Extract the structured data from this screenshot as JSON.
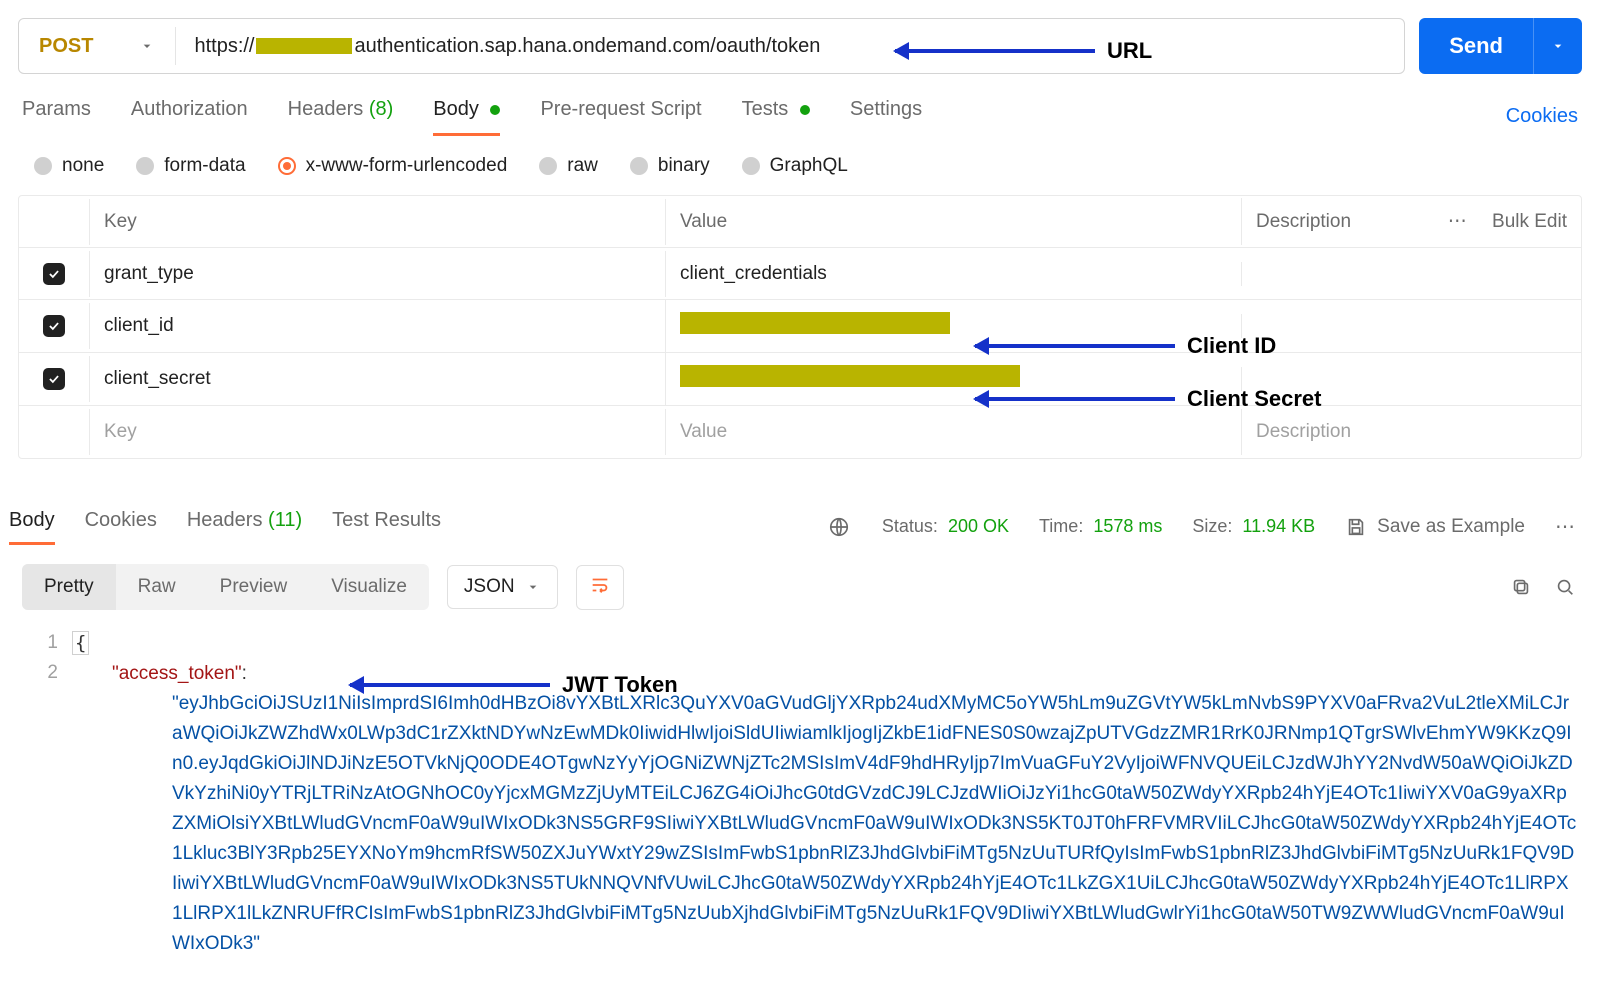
{
  "request": {
    "method": "POST",
    "url_parts": {
      "pre": "https://",
      "post": "authentication.sap.hana.ondemand.com/oauth/token"
    },
    "send_label": "Send"
  },
  "reqTabs": {
    "params": "Params",
    "authorization": "Authorization",
    "headers": "Headers",
    "headers_count": "(8)",
    "body": "Body",
    "prerequest": "Pre-request Script",
    "tests": "Tests",
    "settings": "Settings",
    "cookies": "Cookies"
  },
  "bodyTypes": {
    "none": "none",
    "formdata": "form-data",
    "xwww": "x-www-form-urlencoded",
    "raw": "raw",
    "binary": "binary",
    "graphql": "GraphQL"
  },
  "kv": {
    "header_key": "Key",
    "header_value": "Value",
    "header_desc": "Description",
    "bulk_edit": "Bulk Edit",
    "rows": [
      {
        "key": "grant_type",
        "value": "client_credentials",
        "redacted": false
      },
      {
        "key": "client_id",
        "value": "",
        "redacted": true,
        "redact_width": 270
      },
      {
        "key": "client_secret",
        "value": "",
        "redacted": true,
        "redact_width": 340
      }
    ],
    "placeholder_key": "Key",
    "placeholder_value": "Value",
    "placeholder_desc": "Description"
  },
  "respTabs": {
    "body": "Body",
    "cookies": "Cookies",
    "headers": "Headers",
    "headers_count": "(11)",
    "results": "Test Results"
  },
  "status": {
    "status_label": "Status:",
    "status_value": "200 OK",
    "time_label": "Time:",
    "time_value": "1578 ms",
    "size_label": "Size:",
    "size_value": "11.94 KB",
    "save_example": "Save as Example"
  },
  "respControls": {
    "pretty": "Pretty",
    "raw": "Raw",
    "preview": "Preview",
    "visualize": "Visualize",
    "format": "JSON"
  },
  "response_json": {
    "key": "\"access_token\"",
    "colon": ":",
    "value": "\"eyJhbGciOiJSUzI1NiIsImprdSI6Imh0dHBzOi8vYXBtLXRlc3QuYXV0aGVudGljYXRpb24udXMyMC5oYW5hLm9uZGVtYW5kLmNvbS9PYXV0aFRva2VuL2tleXMiLCJraWQiOiJkZWZhdWx0LWp3dC1rZXktNDYwNzEwMDk0IiwidHlwIjoiSldUIiwiamlkIjogIjZkbE1idFNES0S0wzajZpUTVGdzZMR1RrK0JRNmp1QTgrSWlvEhmYW9KKzQ9In0.eyJqdGkiOiJlNDJiNzE5OTVkNjQ0ODE4OTgwNzYyYjOGNiZWNjZTc2MSIsImV4dF9hdHRyIjp7ImVuaGFuY2VyIjoiWFNVQUEiLCJzdWJhYY2NvdW50aWQiOiJkZDVkYzhiNi0yYTRjLTRiNzAtOGNhOC0yYjcxMGMzZjUyMTEiLCJ6ZG4iOiJhcG0tdGVzdCJ9LCJzdWIiOiJzYi1hcG0taW50ZWdyYXRpb24hYjE4OTc1IiwiYXV0aG9yaXRpZXMiOlsiYXBtLWludGVncmF0aW9uIWIxODk3NS5GRF9SIiwiYXBtLWludGVncmF0aW9uIWIxODk3NS5KT0JT0hFRFVMRVIiLCJhcG0taW50ZWdyYXRpb24hYjE4OTc1Lkluc3BlY3Rpb25EYXNoYm9hcmRfSW50ZXJuYWxtY29wZSIsImFwbS1pbnRlZ3JhdGlvbiFiMTg5NzUuTURfQyIsImFwbS1pbnRlZ3JhdGlvbiFiMTg5NzUuRk1FQV9DIiwiYXBtLWludGVncmF0aW9uIWIxODk3NS5TUkNNQVNfVUwiLCJhcG0taW50ZWdyYXRpb24hYjE4OTc1LkZGX1UiLCJhcG0taW50ZWdyYXRpb24hYjE4OTc1LlRPX1LlRPX1lLkZNRUFfRCIsImFwbS1pbnRlZ3JhdGlvbiFiMTg5NzUubXjhdGlvbiFiMTg5NzUuRk1FQV9DIiwiYXBtLWludGwlrYi1hcG0taW50TW9ZWWludGVncmF0aW9uIWIxODk3\""
  },
  "annotations": {
    "url": "URL",
    "client_id": "Client ID",
    "client_secret": "Client Secret",
    "jwt": "JWT Token"
  }
}
